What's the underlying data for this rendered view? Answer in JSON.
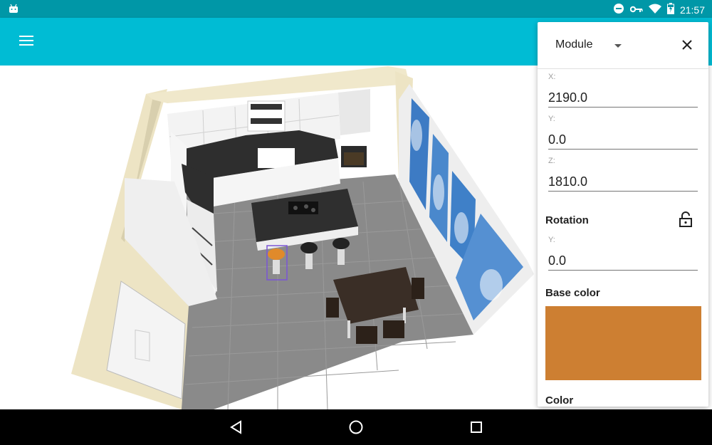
{
  "status_bar": {
    "time": "21:57",
    "icons": [
      "android-icon",
      "do-not-disturb-icon",
      "vpn-key-icon",
      "wifi-icon",
      "battery-charging-icon"
    ]
  },
  "app_bar": {
    "menu_icon": "hamburger-menu-icon"
  },
  "panel": {
    "module_label": "Module",
    "close_icon": "close-icon",
    "fields": {
      "x_label": "X:",
      "x_value": "2190.0",
      "y_label": "Y:",
      "y_value": "0.0",
      "z_label": "Z:",
      "z_value": "1810.0"
    },
    "rotation": {
      "title": "Rotation",
      "y_label": "Y:",
      "y_value": "0.0",
      "lock_icon": "lock-open-icon"
    },
    "base_color": {
      "title": "Base color",
      "value": "#cd7f32"
    },
    "color": {
      "title": "Color"
    }
  },
  "colors": {
    "status_bar": "#0097a7",
    "app_bar": "#00bcd4",
    "nav_bar": "#000000"
  },
  "nav_bar": {
    "icons": [
      "back-icon",
      "home-icon",
      "recents-icon"
    ]
  }
}
